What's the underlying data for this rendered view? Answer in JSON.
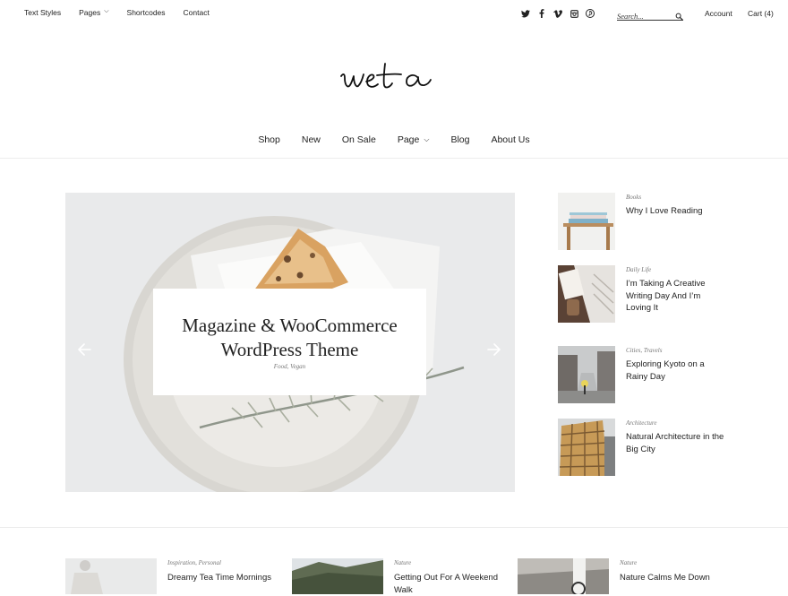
{
  "topbar": {
    "nav": [
      {
        "label": "Text Styles",
        "has_dropdown": false
      },
      {
        "label": "Pages",
        "has_dropdown": true
      },
      {
        "label": "Shortcodes",
        "has_dropdown": false
      },
      {
        "label": "Contact",
        "has_dropdown": false
      }
    ],
    "socials": [
      "twitter-icon",
      "facebook-icon",
      "vimeo-icon",
      "instagram-icon",
      "pinterest-icon"
    ],
    "search_placeholder": "Search...",
    "account_label": "Account",
    "cart_label": "Cart (4)"
  },
  "logo": {
    "text": "weta"
  },
  "mainnav": [
    {
      "label": "Shop",
      "has_dropdown": false
    },
    {
      "label": "New",
      "has_dropdown": false
    },
    {
      "label": "On Sale",
      "has_dropdown": false
    },
    {
      "label": "Page",
      "has_dropdown": true
    },
    {
      "label": "Blog",
      "has_dropdown": false
    },
    {
      "label": "About Us",
      "has_dropdown": false
    }
  ],
  "slider": {
    "title_line1": "Magazine & WooCommerce",
    "title_line2": "WordPress Theme",
    "categories": "Food, Vegan"
  },
  "sidebar_posts": [
    {
      "category": "Books",
      "title": "Why I Love Reading"
    },
    {
      "category": "Daily Life",
      "title": "I’m Taking A Creative Writing Day And I’m Loving It"
    },
    {
      "category": "Cities, Travels",
      "title": "Exploring Kyoto on a Rainy Day"
    },
    {
      "category": "Architecture",
      "title": "Natural Architecture in the Big City"
    }
  ],
  "bottom_posts": [
    {
      "category": "Inspiration, Personal",
      "title": "Dreamy Tea Time Mornings"
    },
    {
      "category": "Nature",
      "title": "Getting Out For A Weekend Walk"
    },
    {
      "category": "Nature",
      "title": "Nature Calms Me Down"
    }
  ],
  "colors": {
    "text": "#222222",
    "muted": "#777777",
    "rule": "#ececec",
    "slider_bg": "#e9eaeb"
  }
}
